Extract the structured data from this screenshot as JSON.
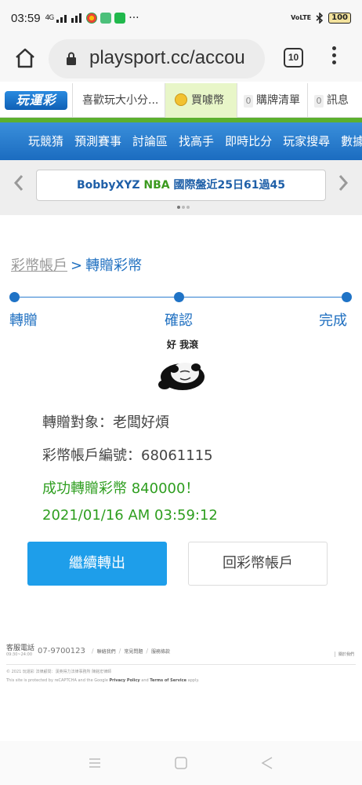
{
  "status_bar": {
    "time": "03:59",
    "network": "4G",
    "battery": "100",
    "volte": "VoLTE",
    "more": "···"
  },
  "browser": {
    "url": "playsport.cc/accou",
    "tab_count": "10"
  },
  "site_header": {
    "logo": "玩運彩",
    "user": "喜歡玩大小分...",
    "buy_coins": "買噱幣",
    "cart_count": "0",
    "cart": "購牌清單",
    "msg_count": "0",
    "messages": "訊息"
  },
  "nav": {
    "items": [
      "玩競猜",
      "預測賽事",
      "討論區",
      "找高手",
      "即時比分",
      "玩家搜尋",
      "數據"
    ]
  },
  "ticker": {
    "user": "BobbyXYZ",
    "league": "NBA",
    "text": "國際盤近25日61過45"
  },
  "breadcrumb": {
    "parent": "彩幣帳戶",
    "separator": ">",
    "current": "轉贈彩幣"
  },
  "steps": [
    "轉贈",
    "確認",
    "完成"
  ],
  "sticker": {
    "caption": "好 我滾"
  },
  "details": {
    "recipient": "轉贈對象：老闆好煩",
    "account_no": "彩幣帳戶編號：68061115",
    "success": "成功轉贈彩幣 840000！",
    "timestamp": "2021/01/16 AM 03:59:12"
  },
  "buttons": {
    "continue": "繼續轉出",
    "back": "回彩幣帳戶"
  },
  "footer": {
    "hotline_label": "客服電話",
    "hours": "09:30~24:00",
    "phone": "07-9700123",
    "links": [
      "聯絡我們",
      "常見問題",
      "服務條款"
    ],
    "about": "關於我們",
    "copyright": "© 2021 玩運彩 法律顧問：漢英得力法律事務所 陳銘宏律師",
    "captcha_a": "This site is protected by reCAPTCHA and the Google",
    "privacy": "Privacy Policy",
    "and": "and",
    "terms": "Terms of Service",
    "apply": "apply."
  },
  "colors": {
    "accent_blue": "#1e6fc0",
    "button_blue": "#1e9eea",
    "success_green": "#2e9e1f",
    "header_green": "#5cb02e"
  }
}
